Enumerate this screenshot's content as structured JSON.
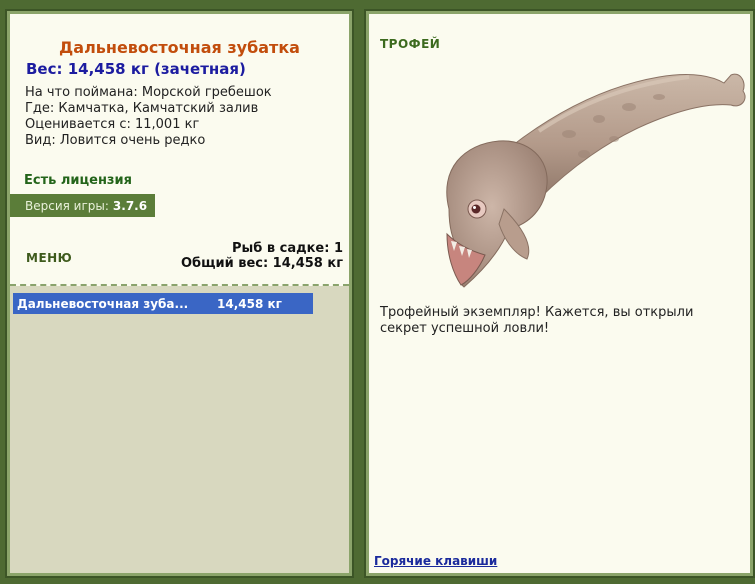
{
  "fish": {
    "title": "Дальневосточная зубатка",
    "weight": "Вес: 14,458 кг (зачетная)",
    "bait": "На что поймана: Морской гребешок",
    "place": "Где: Камчатка, Камчатский залив",
    "price": "Оценивается с: 11,001 кг",
    "rarity": "Вид: Ловится очень редко"
  },
  "status": {
    "license": "Есть лицензия",
    "version_label": "Версия игры:",
    "version_value": "3.7.6"
  },
  "menu": {
    "label": "МЕНЮ"
  },
  "stats": {
    "fish_in_keepnet": "Рыб в садке: 1",
    "total_weight": "Общий вес: 14,458 кг"
  },
  "catch_list": [
    {
      "name": "Дальневосточная зуба...",
      "weight": "14,458 кг"
    }
  ],
  "trophy": {
    "label": "ТРОФЕЙ",
    "text": "Трофейный экземпляр! Кажется, вы открыли секрет успешной ловли!",
    "image_icon": "wolffish-image"
  },
  "footer": {
    "hotkeys": "Горячие клавиши"
  },
  "colors": {
    "frame": "#4e6a32",
    "panel": "#fbfbef",
    "title": "#c24d0c",
    "weight": "#1c1ca0",
    "selection": "#3a66c5"
  }
}
